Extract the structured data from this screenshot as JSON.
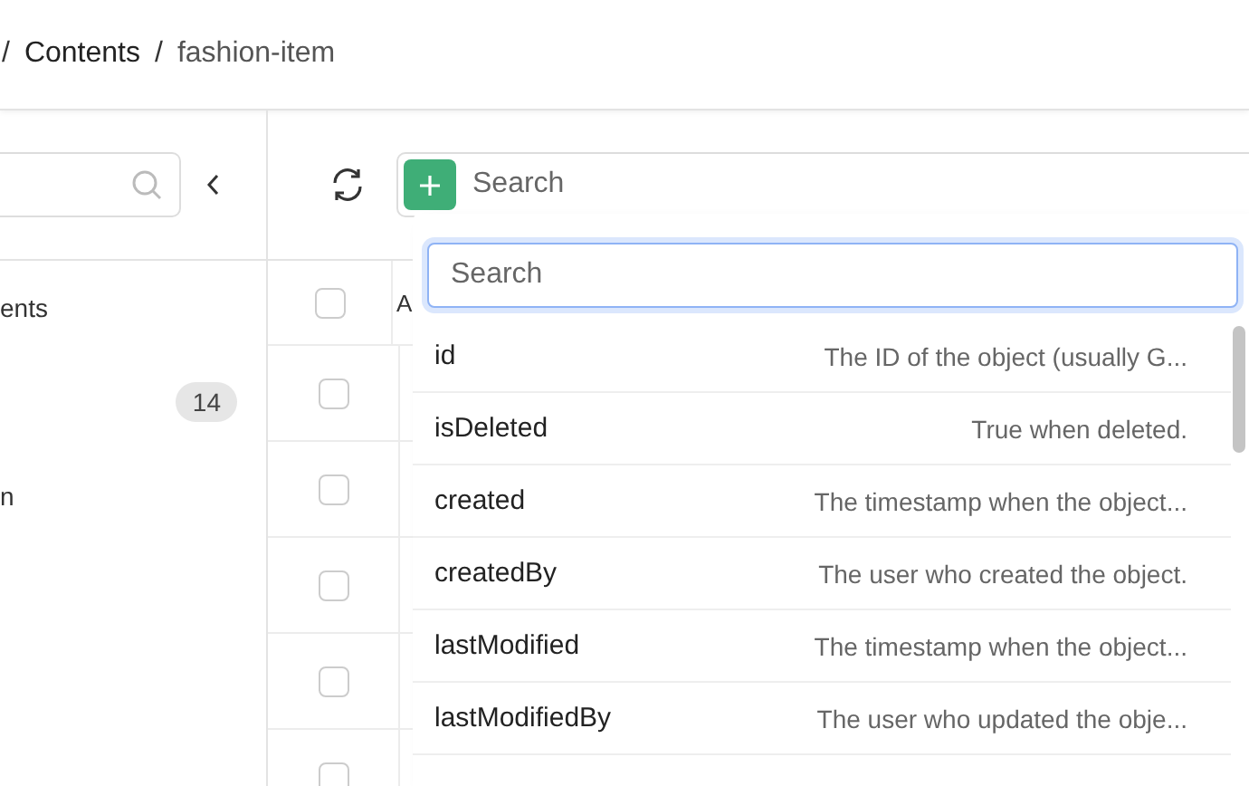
{
  "breadcrumb": [
    {
      "label": "/",
      "kind": "separator"
    },
    {
      "label": "Contents",
      "kind": "link"
    },
    {
      "label": "/",
      "kind": "separator"
    },
    {
      "label": "fashion-item",
      "kind": "current"
    }
  ],
  "sidebar": {
    "items": [
      {
        "label": "ents"
      },
      {
        "badge": "14"
      },
      {
        "label": "n"
      }
    ]
  },
  "toolbar": {
    "search": {
      "placeholder": "Search"
    }
  },
  "table": {
    "select_all_checked": false,
    "columns": [
      "A"
    ],
    "rows": [
      {
        "checked": false
      },
      {
        "checked": false
      },
      {
        "checked": false
      },
      {
        "checked": false
      },
      {
        "checked": false
      }
    ]
  },
  "dropdown": {
    "search": {
      "placeholder": "Search"
    },
    "items": [
      {
        "name": "id",
        "description": "The ID of the object (usually G..."
      },
      {
        "name": "isDeleted",
        "description": "True when deleted."
      },
      {
        "name": "created",
        "description": "The timestamp when the object..."
      },
      {
        "name": "createdBy",
        "description": "The user who created the object."
      },
      {
        "name": "lastModified",
        "description": "The timestamp when the object..."
      },
      {
        "name": "lastModifiedBy",
        "description": "The user who updated the obje..."
      }
    ]
  }
}
